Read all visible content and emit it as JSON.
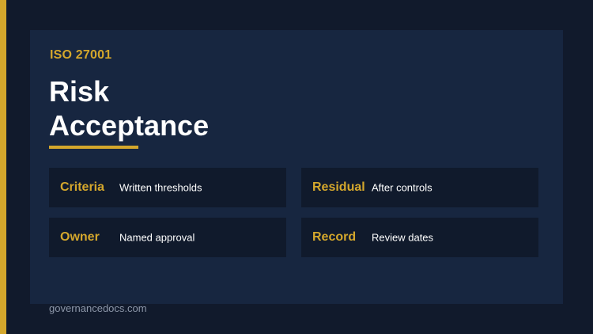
{
  "slide": {
    "eyebrow": "ISO 27001",
    "title": "Risk\nAcceptance",
    "footer": "governancedocs.com",
    "accent_color": "#d4a72c",
    "background_color": "#111a2c",
    "panel_color": "#172640"
  },
  "cards": [
    {
      "label": "Criteria",
      "value": "Written thresholds"
    },
    {
      "label": "Residual",
      "value": "After controls"
    },
    {
      "label": "Owner",
      "value": "Named approval"
    },
    {
      "label": "Record",
      "value": "Review dates"
    }
  ]
}
